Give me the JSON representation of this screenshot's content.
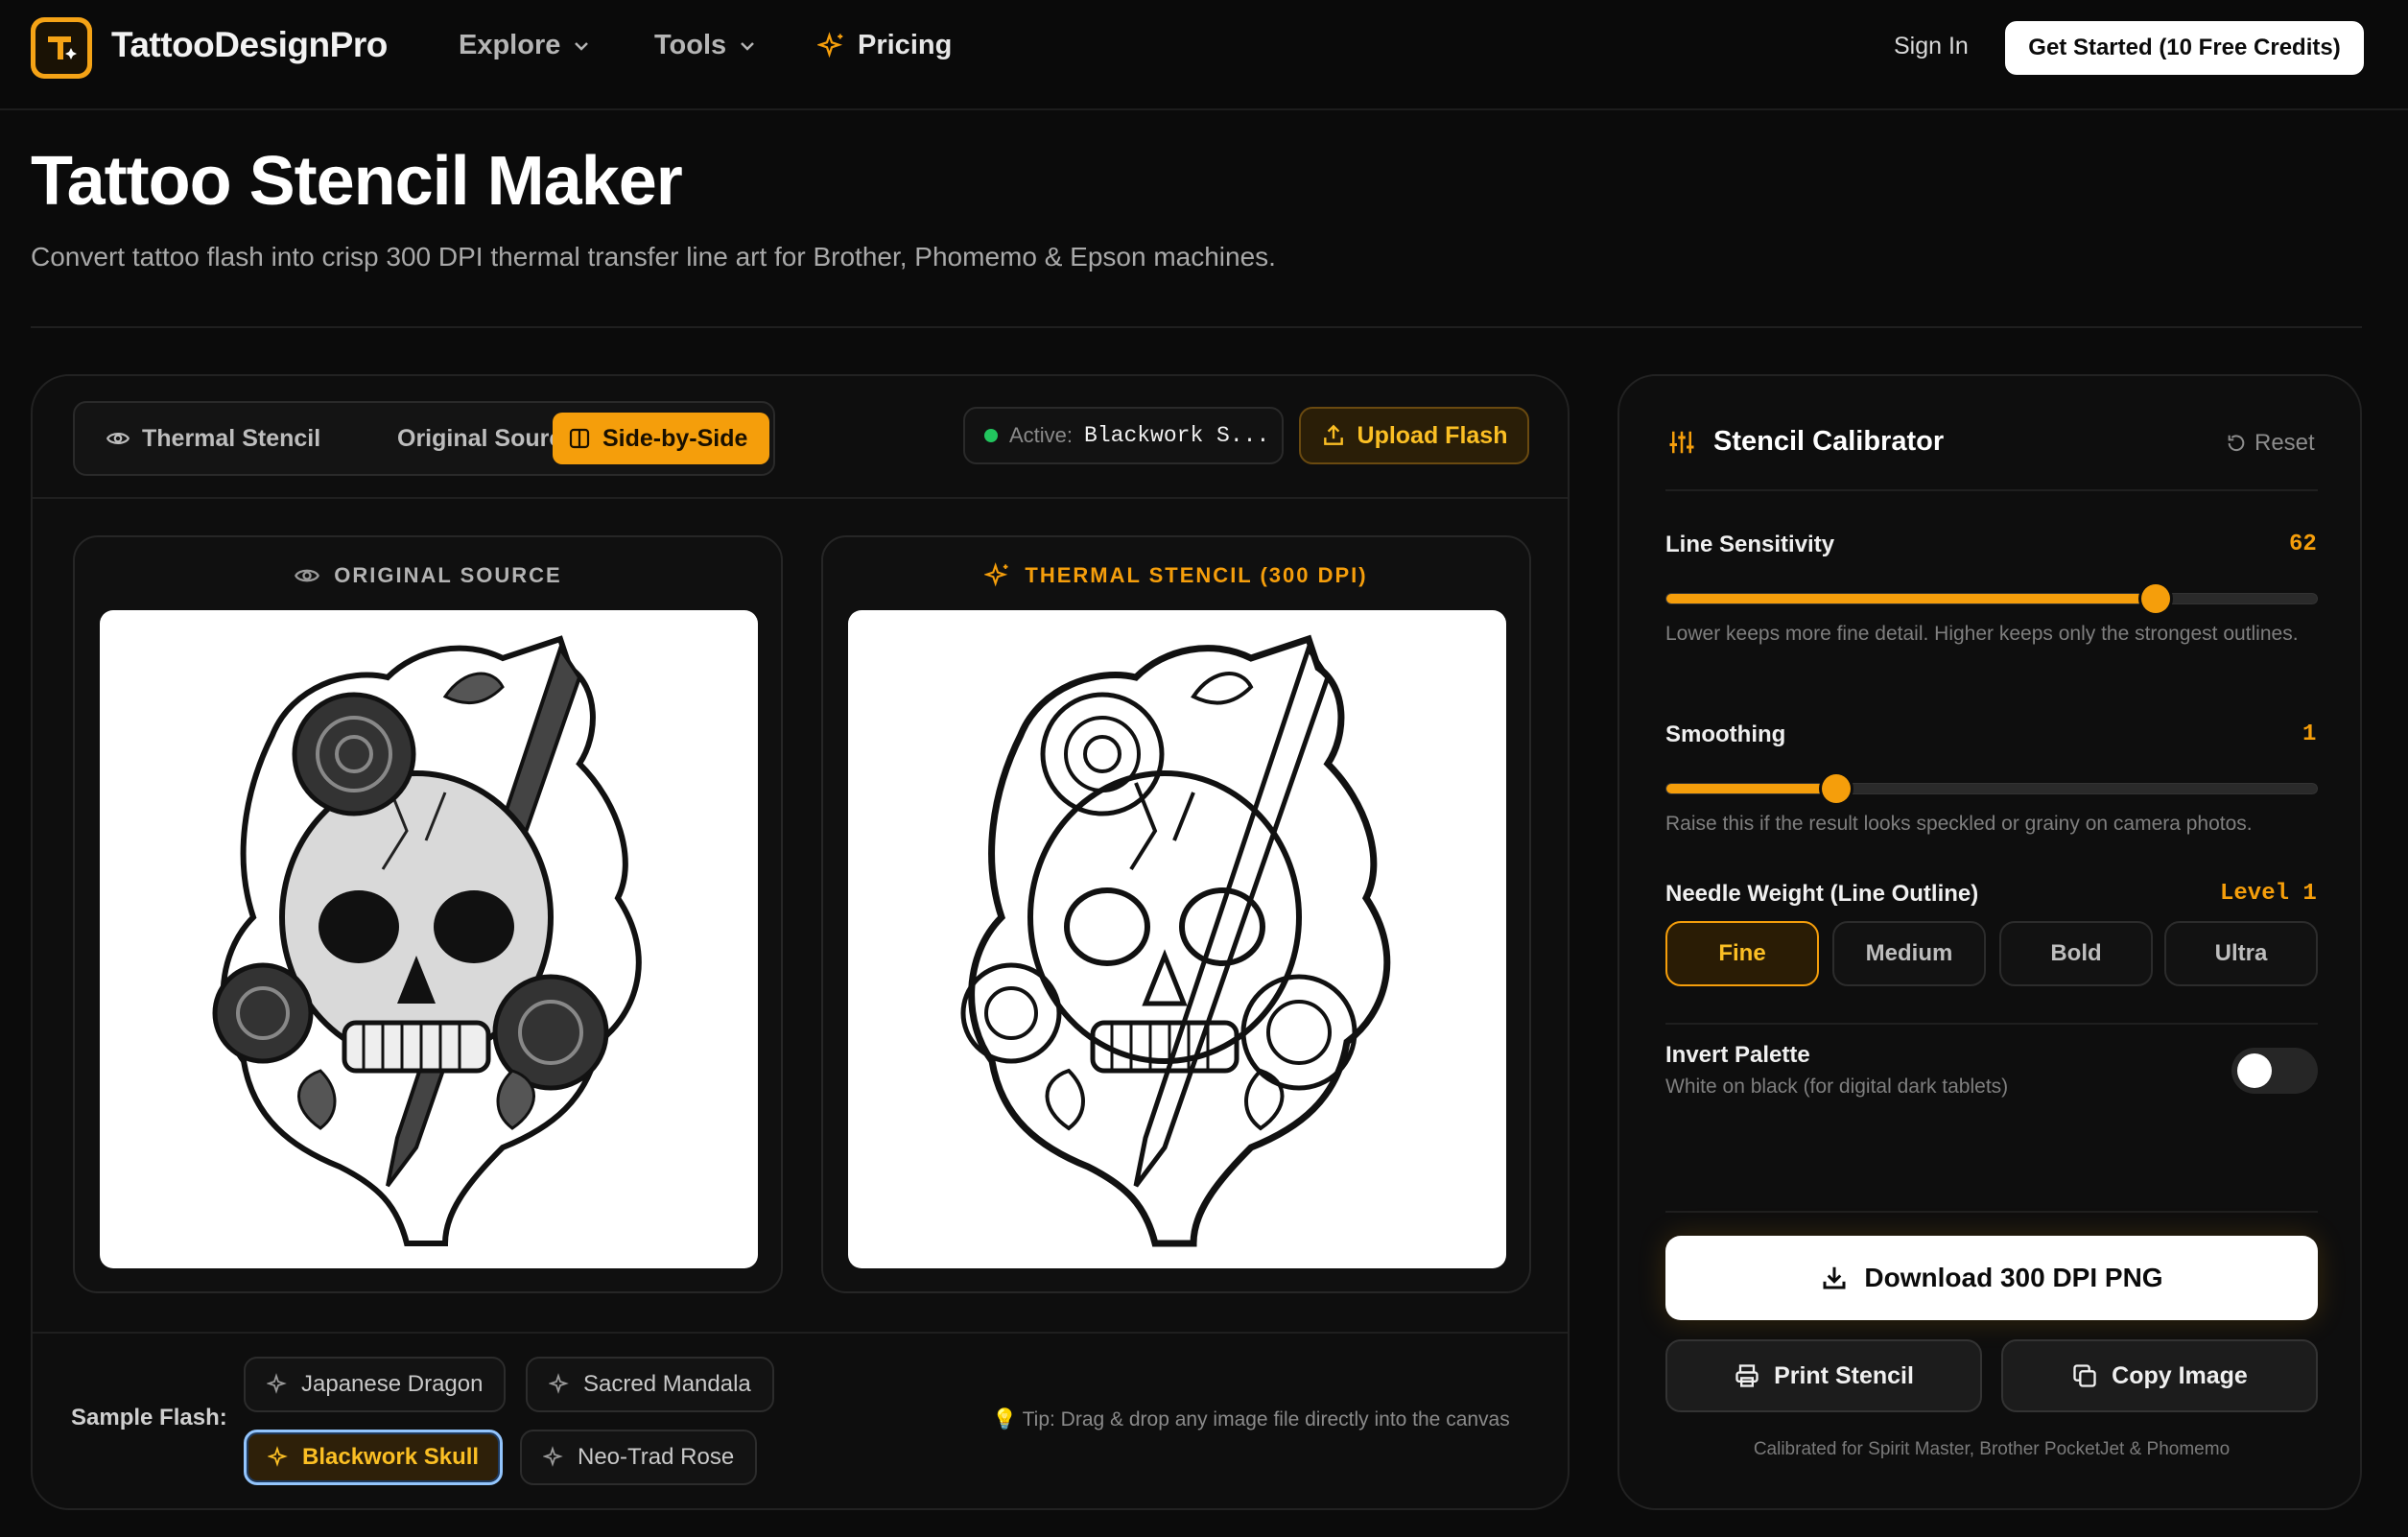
{
  "nav": {
    "brand": "TattooDesignPro",
    "explore": "Explore",
    "tools": "Tools",
    "pricing": "Pricing",
    "sign_in": "Sign In",
    "get_started": "Get Started (10 Free Credits)"
  },
  "header": {
    "title": "Tattoo Stencil Maker",
    "subtitle": "Convert tattoo flash into crisp 300 DPI thermal transfer line art for Brother, Phomemo & Epson machines."
  },
  "toolbar": {
    "tabs": [
      "Thermal Stencil",
      "Original Source",
      "Side-by-Side"
    ],
    "active_tab": "Side-by-Side",
    "active_label": "Active:",
    "active_value": "Blackwork S...",
    "upload_label": "Upload Flash"
  },
  "preview": {
    "original_title": "ORIGINAL SOURCE",
    "stencil_title": "THERMAL STENCIL (300 DPI)"
  },
  "samples": {
    "label": "Sample Flash:",
    "items": [
      "Japanese Dragon",
      "Sacred Mandala",
      "Blackwork Skull",
      "Neo-Trad Rose"
    ],
    "selected": "Blackwork Skull",
    "tip": "💡 Tip: Drag & drop any image file directly into the canvas"
  },
  "calibrator": {
    "title": "Stencil Calibrator",
    "reset": "Reset",
    "line_sensitivity": {
      "label": "Line Sensitivity",
      "value": 62,
      "fraction": 0.75,
      "help": "Lower keeps more fine detail. Higher keeps only the strongest outlines."
    },
    "smoothing": {
      "label": "Smoothing",
      "value": 1,
      "fraction": 0.26,
      "help": "Raise this if the result looks speckled or grainy on camera photos."
    },
    "needle": {
      "label": "Needle Weight (Line Outline)",
      "value": "Level 1",
      "options": [
        "Fine",
        "Medium",
        "Bold",
        "Ultra"
      ],
      "selected": "Fine"
    },
    "invert": {
      "label": "Invert Palette",
      "help": "White on black (for digital dark tablets)",
      "on": false
    },
    "download": "Download 300 DPI PNG",
    "print": "Print Stencil",
    "copy": "Copy Image",
    "footer": "Calibrated for Spirit Master, Brother PocketJet & Phomemo"
  },
  "colors": {
    "accent": "#f59e0b",
    "background": "#0b0b0b",
    "panel": "#0e0e0e",
    "status_green": "#22c55e"
  },
  "icons": {
    "logo": "tattoo-machine-icon",
    "chevron": "chevron-down-icon",
    "sparkle": "sparkle-icon",
    "eye": "eye-icon",
    "columns": "columns-icon",
    "upload": "upload-icon",
    "sliders": "sliders-icon",
    "reset": "reset-icon",
    "download": "download-icon",
    "printer": "printer-icon",
    "copy": "copy-icon"
  }
}
